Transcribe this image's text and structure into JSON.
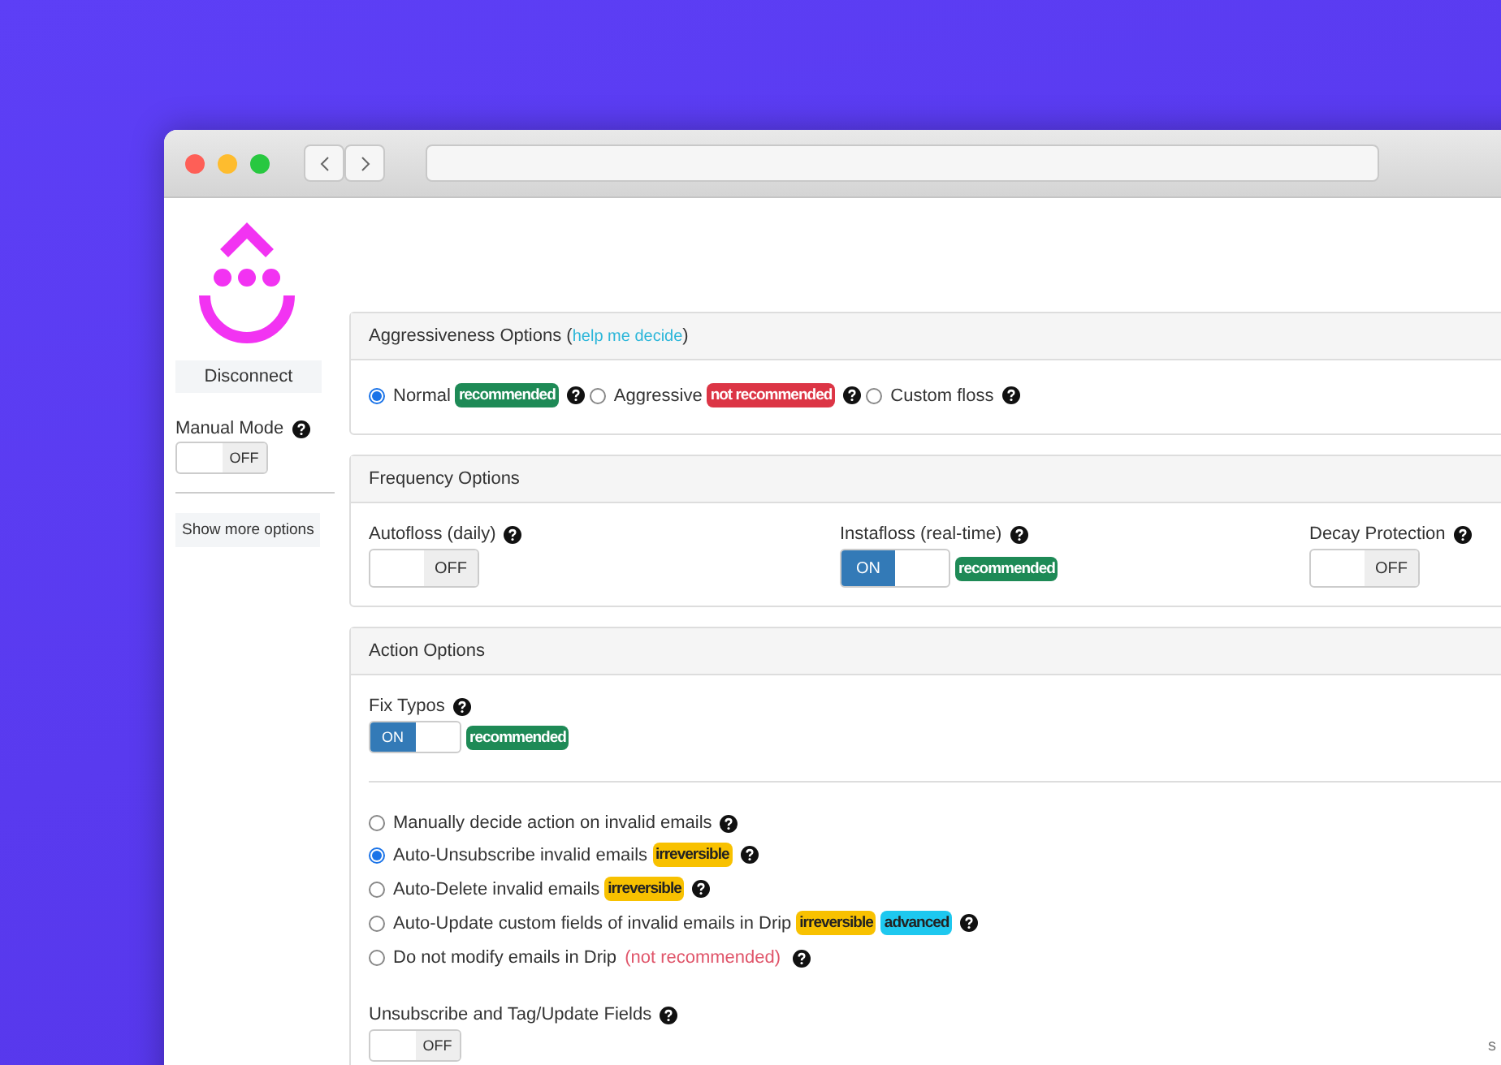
{
  "sidebar": {
    "disconnect": "Disconnect",
    "manual_mode": {
      "label": "Manual Mode",
      "on": false,
      "state_label": "OFF"
    },
    "show_more": "Show more options"
  },
  "aggressiveness": {
    "title_before": "Aggressiveness Options (",
    "link": "help me decide",
    "title_after": ")",
    "options": [
      {
        "label": "Normal",
        "selected": true,
        "badges": [
          {
            "text": "recommended",
            "kind": "success"
          }
        ]
      },
      {
        "label": "Aggressive",
        "selected": false,
        "badges": [
          {
            "text": "not recommended",
            "kind": "danger"
          }
        ]
      },
      {
        "label": "Custom floss",
        "selected": false
      }
    ]
  },
  "frequency": {
    "title": "Frequency Options",
    "toggles": [
      {
        "label": "Autofloss (daily)",
        "on": false,
        "state_label": "OFF"
      },
      {
        "label": "Instafloss (real-time)",
        "on": true,
        "state_label": "ON",
        "badges": [
          {
            "text": "recommended",
            "kind": "success"
          }
        ]
      },
      {
        "label": "Decay Protection",
        "on": false,
        "state_label": "OFF"
      }
    ]
  },
  "actions": {
    "title": "Action Options",
    "fix_typos": {
      "label": "Fix Typos",
      "on": true,
      "state_label": "ON",
      "badges": [
        {
          "text": "recommended",
          "kind": "success"
        }
      ]
    },
    "options": [
      {
        "label": "Manually decide action on invalid emails",
        "selected": false
      },
      {
        "label": "Auto-Unsubscribe invalid emails",
        "selected": true,
        "badges": [
          {
            "text": "irreversible",
            "kind": "warning"
          }
        ]
      },
      {
        "label": "Auto-Delete invalid emails",
        "selected": false,
        "badges": [
          {
            "text": "irreversible",
            "kind": "warning"
          }
        ]
      },
      {
        "label": "Auto-Update custom fields of invalid emails in Drip",
        "selected": false,
        "badges": [
          {
            "text": "irreversible",
            "kind": "warning"
          },
          {
            "text": "advanced",
            "kind": "info"
          }
        ]
      },
      {
        "label": "Do not modify emails in Drip",
        "selected": false,
        "badges": [
          {
            "text": "(not recommended)",
            "kind": "note"
          }
        ]
      }
    ],
    "unsubscribe_tag": {
      "label": "Unsubscribe and Tag/Update Fields",
      "on": false,
      "state_label": "OFF"
    },
    "edge_text": "s"
  }
}
